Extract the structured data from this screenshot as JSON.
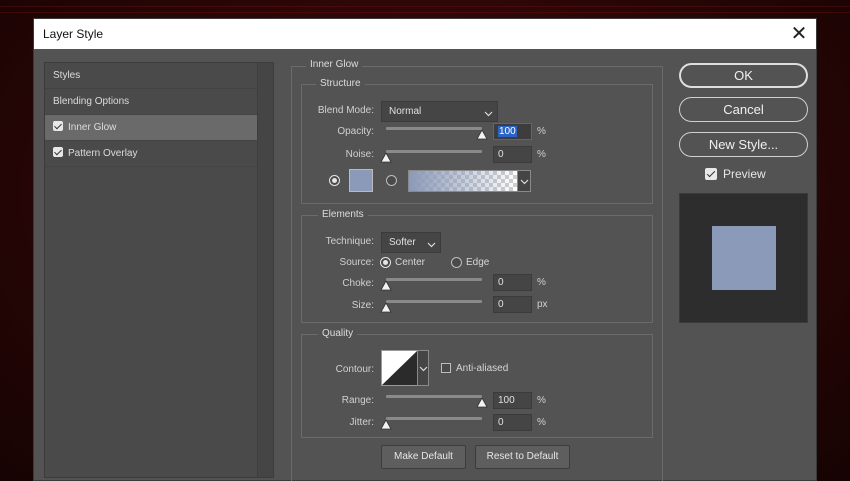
{
  "window": {
    "title": "Layer Style",
    "close_glyph": "✕"
  },
  "styles_list": [
    {
      "label": "Styles",
      "checkbox": false,
      "active": false
    },
    {
      "label": "Blending Options",
      "checkbox": false,
      "active": false
    },
    {
      "label": "Inner Glow",
      "checkbox": true,
      "active": true
    },
    {
      "label": "Pattern Overlay",
      "checkbox": true,
      "active": false
    }
  ],
  "section_title": "Inner Glow",
  "structure": {
    "legend": "Structure",
    "blend_mode_label": "Blend Mode:",
    "blend_mode_value": "Normal",
    "opacity_label": "Opacity:",
    "opacity_value": "100",
    "opacity_fraction": 1.0,
    "opacity_unit": "%",
    "noise_label": "Noise:",
    "noise_value": "0",
    "noise_fraction": 0.0,
    "noise_unit": "%",
    "glow_color": "#8b9ab8"
  },
  "elements": {
    "legend": "Elements",
    "technique_label": "Technique:",
    "technique_value": "Softer",
    "source_label": "Source:",
    "source_center": "Center",
    "source_edge": "Edge",
    "choke_label": "Choke:",
    "choke_value": "0",
    "choke_fraction": 0.0,
    "choke_unit": "%",
    "size_label": "Size:",
    "size_value": "0",
    "size_fraction": 0.0,
    "size_unit": "px"
  },
  "quality": {
    "legend": "Quality",
    "contour_label": "Contour:",
    "anti_aliased_label": "Anti-aliased",
    "range_label": "Range:",
    "range_value": "100",
    "range_fraction": 1.0,
    "range_unit": "%",
    "jitter_label": "Jitter:",
    "jitter_value": "0",
    "jitter_fraction": 0.0,
    "jitter_unit": "%"
  },
  "buttons": {
    "make_default": "Make Default",
    "reset_to_default": "Reset to Default",
    "ok": "OK",
    "cancel": "Cancel",
    "new_style": "New Style..."
  },
  "preview": {
    "label": "Preview",
    "checked": true,
    "swatch_color": "#8b9ab8"
  },
  "colors": {
    "dialog_bg": "#535353",
    "titlebar_bg": "#ffffff",
    "focus_accent": "#2b63c7"
  }
}
